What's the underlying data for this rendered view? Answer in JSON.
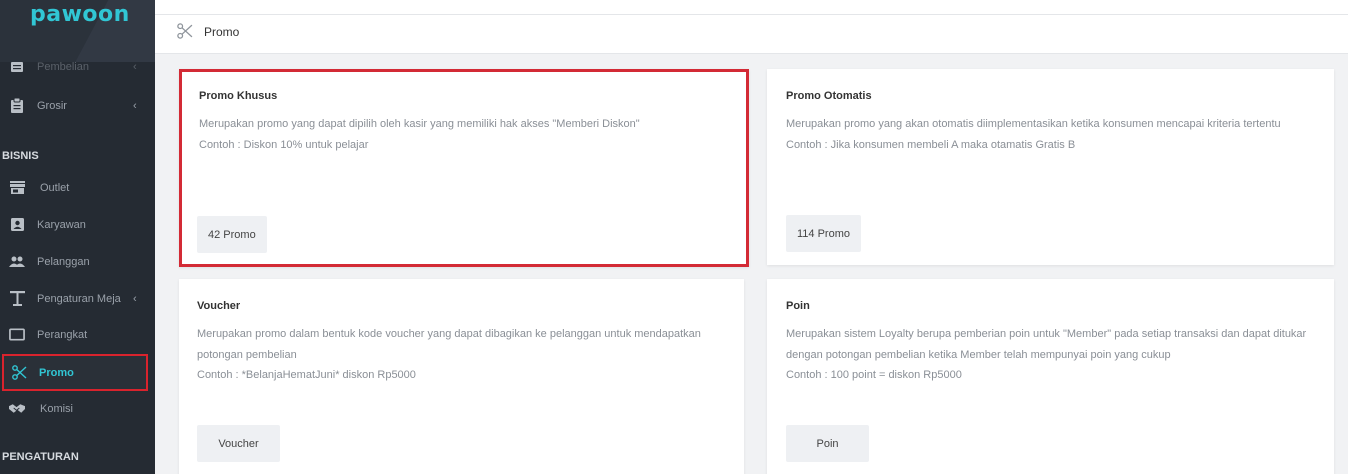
{
  "app": {
    "logo": "pawoon"
  },
  "sidebar": {
    "partial_item": {
      "label": "Pembelian",
      "icon": "list-icon"
    },
    "items_top": [
      {
        "label": "Grosir",
        "icon": "clipboard-icon",
        "has_submenu": true
      }
    ],
    "section_bisnis": "BISNIS",
    "items_bisnis": [
      {
        "label": "Outlet",
        "icon": "store-icon"
      },
      {
        "label": "Karyawan",
        "icon": "id-card-icon"
      },
      {
        "label": "Pelanggan",
        "icon": "people-icon"
      },
      {
        "label": "Pengaturan Meja",
        "icon": "table-icon",
        "has_submenu": true
      },
      {
        "label": "Perangkat",
        "icon": "tablet-icon"
      },
      {
        "label": "Promo",
        "icon": "scissors-icon",
        "active": true
      },
      {
        "label": "Komisi",
        "icon": "handshake-icon"
      }
    ],
    "section_pengaturan": "PENGATURAN",
    "chevron": "‹"
  },
  "breadcrumb": {
    "icon": "scissors-icon",
    "label": "Promo"
  },
  "cards": [
    {
      "title": "Promo Khusus",
      "description": [
        "Merupakan promo yang dapat dipilih oleh kasir yang memiliki hak akses \"Memberi Diskon\"",
        "Contoh : Diskon 10% untuk pelajar"
      ],
      "button": "42 Promo",
      "highlighted": true
    },
    {
      "title": "Promo Otomatis",
      "description": [
        "Merupakan promo yang akan otomatis diimplementasikan ketika konsumen mencapai kriteria tertentu",
        "Contoh : Jika konsumen membeli A maka otamatis Gratis B"
      ],
      "button": "114 Promo"
    },
    {
      "title": "Voucher",
      "description": [
        "Merupakan promo dalam bentuk kode voucher yang dapat dibagikan ke pelanggan untuk mendapatkan",
        "potongan pembelian",
        "Contoh : *BelanjaHematJuni* diskon Rp5000"
      ],
      "button": "Voucher"
    },
    {
      "title": "Poin",
      "description": [
        "Merupakan sistem Loyalty berupa pemberian poin untuk \"Member\" pada setiap transaksi dan dapat ditukar",
        "dengan potongan pembelian ketika Member telah mempunyai poin yang cukup",
        "Contoh : 100 point = diskon Rp5000"
      ],
      "button": "Poin"
    }
  ],
  "colors": {
    "accent": "#31c6d4",
    "sidebar_bg": "#252b33",
    "highlight": "#d32a35"
  }
}
